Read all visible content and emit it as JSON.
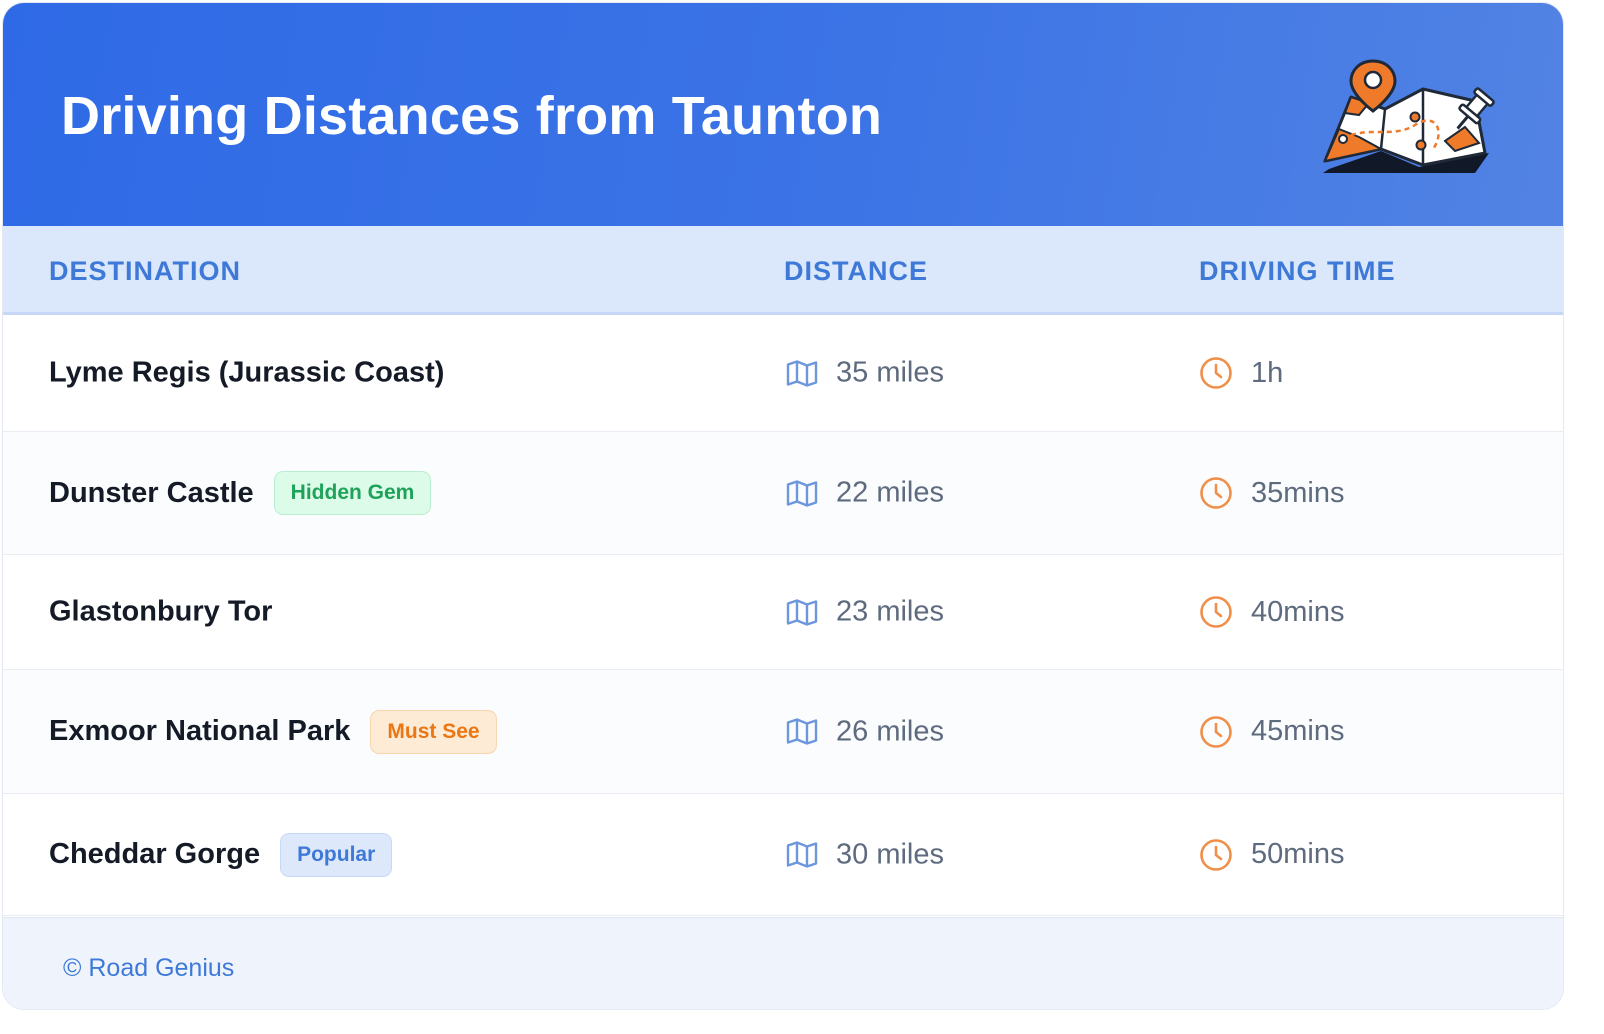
{
  "header": {
    "title": "Driving Distances from Taunton",
    "illustration_icon": "map-with-pins-icon"
  },
  "table": {
    "columns": [
      "DESTINATION",
      "DISTANCE",
      "DRIVING TIME"
    ],
    "rows": [
      {
        "destination": "Lyme Regis (Jurassic Coast)",
        "badge": "",
        "distance": "35 miles",
        "time": "1h"
      },
      {
        "destination": "Dunster Castle",
        "badge": "Hidden Gem",
        "badge_style": "green",
        "distance": "22 miles",
        "time": "35mins"
      },
      {
        "destination": "Glastonbury Tor",
        "badge": "",
        "distance": "23 miles",
        "time": "40mins"
      },
      {
        "destination": "Exmoor National Park",
        "badge": "Must See",
        "badge_style": "orange",
        "distance": "26 miles",
        "time": "45mins"
      },
      {
        "destination": "Cheddar Gorge",
        "badge": "Popular",
        "badge_style": "blue",
        "distance": "30 miles",
        "time": "50mins"
      }
    ],
    "distance_icon": "map-icon",
    "time_icon": "clock-icon"
  },
  "footer": {
    "text": "© Road Genius"
  },
  "colors": {
    "header_blue": "#2f6ae6",
    "accent_blue": "#3e79d8",
    "accent_orange": "#ea7614",
    "accent_green": "#1fa35a"
  }
}
